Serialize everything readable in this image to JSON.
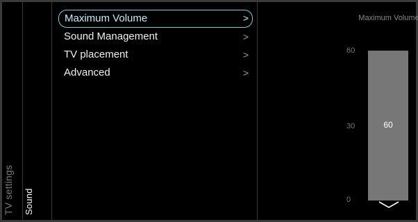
{
  "breadcrumbs": [
    "TV settings",
    "Sound"
  ],
  "menu": {
    "items": [
      {
        "label": "Maximum Volume",
        "selected": true
      },
      {
        "label": "Sound Management",
        "selected": false
      },
      {
        "label": "TV placement",
        "selected": false
      },
      {
        "label": "Advanced",
        "selected": false
      }
    ],
    "chevron_glyph": ">"
  },
  "slider": {
    "title": "Maximum Volume",
    "ticks": {
      "top": "60",
      "mid": "30",
      "bottom": "0"
    },
    "min": 0,
    "max": 60,
    "value": 60,
    "value_label": "60"
  },
  "colors": {
    "background": "#000000",
    "selection_outline": "#7ecfe4",
    "slider_fill": "#777777"
  },
  "icons": {
    "scroll_down": "chevron-down-icon",
    "submenu": "chevron-right-icon"
  }
}
